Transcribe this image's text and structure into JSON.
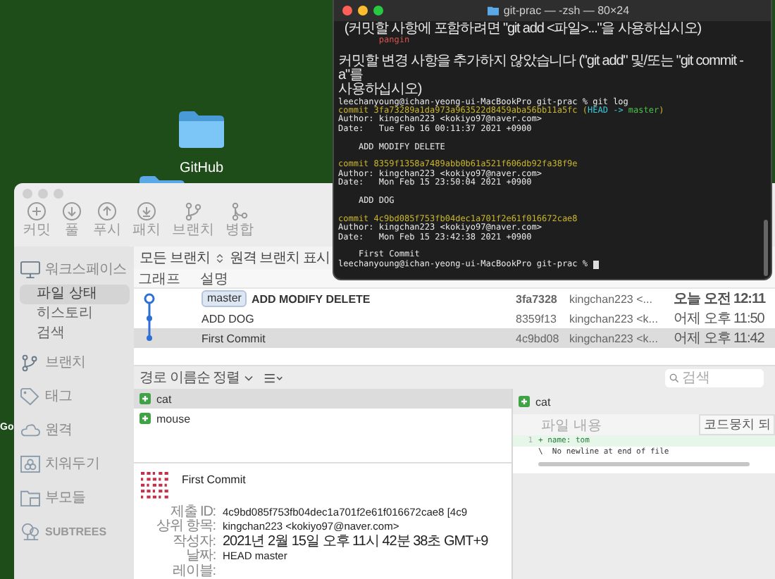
{
  "desktop": {
    "icons": [
      {
        "label": "GitHub"
      }
    ],
    "edge_label": "Go"
  },
  "terminal": {
    "title": "git-prac — -zsh — 80×24",
    "lines": [
      {
        "kind": "notice",
        "segments": [
          {
            "kind": "plain",
            "text": "  (커밋할 사항에 포함하려면 \"git add <파일>...\"을 사용하십시오)"
          }
        ]
      },
      {
        "kind": "text",
        "segments": [
          {
            "kind": "untracked",
            "text": "        pangin"
          }
        ]
      },
      {
        "kind": "blank"
      },
      {
        "kind": "notice",
        "segments": [
          {
            "kind": "plain",
            "text": "커밋할 변경 사항을 추가하지 않았습니다 (\"git add\" 및/또는 \"git commit -a\"를"
          }
        ]
      },
      {
        "kind": "notice",
        "segments": [
          {
            "kind": "plain",
            "text": "사용하십시오)"
          }
        ]
      },
      {
        "kind": "text",
        "segments": [
          {
            "kind": "plain",
            "text": "leechanyoung@ichan-yeong-ui-MacBookPro git-prac % git log"
          }
        ]
      },
      {
        "kind": "text",
        "segments": [
          {
            "kind": "commit",
            "text": "commit 3fa73289a1da973a963522d8459aba56bb11a5fc ("
          },
          {
            "kind": "head",
            "text": "HEAD -> "
          },
          {
            "kind": "branch",
            "text": "master"
          },
          {
            "kind": "commit",
            "text": ")"
          }
        ]
      },
      {
        "kind": "text",
        "segments": [
          {
            "kind": "plain",
            "text": "Author: kingchan223 <kokiyo97@naver.com>"
          }
        ]
      },
      {
        "kind": "text",
        "segments": [
          {
            "kind": "plain",
            "text": "Date:   Tue Feb 16 00:11:37 2021 +0900"
          }
        ]
      },
      {
        "kind": "blank"
      },
      {
        "kind": "text",
        "segments": [
          {
            "kind": "plain",
            "text": "    ADD MODIFY DELETE"
          }
        ]
      },
      {
        "kind": "blank"
      },
      {
        "kind": "text",
        "segments": [
          {
            "kind": "commit",
            "text": "commit 8359f1358a7489abb0b61a521f606db92fa38f9e"
          }
        ]
      },
      {
        "kind": "text",
        "segments": [
          {
            "kind": "plain",
            "text": "Author: kingchan223 <kokiyo97@naver.com>"
          }
        ]
      },
      {
        "kind": "text",
        "segments": [
          {
            "kind": "plain",
            "text": "Date:   Mon Feb 15 23:50:04 2021 +0900"
          }
        ]
      },
      {
        "kind": "blank"
      },
      {
        "kind": "text",
        "segments": [
          {
            "kind": "plain",
            "text": "    ADD DOG"
          }
        ]
      },
      {
        "kind": "blank"
      },
      {
        "kind": "text",
        "segments": [
          {
            "kind": "commit",
            "text": "commit 4c9bd085f753fb04dec1a701f2e61f016672cae8"
          }
        ]
      },
      {
        "kind": "text",
        "segments": [
          {
            "kind": "plain",
            "text": "Author: kingchan223 <kokiyo97@naver.com>"
          }
        ]
      },
      {
        "kind": "text",
        "segments": [
          {
            "kind": "plain",
            "text": "Date:   Mon Feb 15 23:42:38 2021 +0900"
          }
        ]
      },
      {
        "kind": "blank"
      },
      {
        "kind": "text",
        "segments": [
          {
            "kind": "plain",
            "text": "    First Commit"
          }
        ]
      },
      {
        "kind": "prompt",
        "segments": [
          {
            "kind": "plain",
            "text": "leechanyoung@ichan-yeong-ui-MacBookPro git-prac % "
          }
        ]
      }
    ]
  },
  "sourcetree": {
    "toolbar": [
      {
        "kind": "commit",
        "label": "커밋"
      },
      {
        "kind": "pull",
        "label": "풀"
      },
      {
        "kind": "push",
        "label": "푸시"
      },
      {
        "kind": "fetch",
        "label": "패치"
      },
      {
        "kind": "branch",
        "label": "브랜치"
      },
      {
        "kind": "merge",
        "label": "병합"
      }
    ],
    "sidebar": [
      {
        "kind": "monitor",
        "label": "워크스페이스",
        "children": [
          {
            "label": "파일 상태",
            "selected": true
          },
          {
            "label": "히스토리",
            "selected": false
          },
          {
            "label": "검색",
            "selected": false
          }
        ]
      },
      {
        "kind": "branch",
        "label": "브랜치"
      },
      {
        "kind": "tag",
        "label": "태그"
      },
      {
        "kind": "cloud",
        "label": "원격"
      },
      {
        "kind": "stash",
        "label": "치워두기"
      },
      {
        "kind": "folder",
        "label": "부모들"
      },
      {
        "kind": "tree",
        "label": "SUBTREES"
      }
    ],
    "branch_filter": "모든 브랜치",
    "remote_toggle": "원격 브랜치 표시",
    "columns": [
      "그래프",
      "설명"
    ],
    "commits": [
      {
        "selected": false,
        "head": true,
        "branch": "master",
        "description": "ADD MODIFY DELETE",
        "hash": "3fa7328",
        "author": "kingchan223 <...",
        "date": "오늘 오전 12:11"
      },
      {
        "selected": false,
        "head": false,
        "description": "ADD DOG",
        "hash": "8359f13",
        "author": "kingchan223 <k...",
        "date": "어제 오후 11:50"
      },
      {
        "selected": true,
        "head": false,
        "description": "First Commit",
        "hash": "4c9bd08",
        "author": "kingchan223 <k...",
        "date": "어제 오후 11:42"
      }
    ],
    "sort_menu": "경로 이름순 정렬",
    "search": {
      "placeholder": "검색"
    },
    "files": [
      {
        "name": "cat",
        "selected": true
      },
      {
        "name": "mouse",
        "selected": false
      }
    ],
    "commit_detail": {
      "message": "First Commit",
      "labels": [
        "제출 ID:",
        "상위 항목:",
        "작성자:",
        "날짜:",
        "레이블:"
      ],
      "values": [
        "4c9bd085f753fb04dec1a701f2e61f016672cae8 [4c9",
        "kingchan223 <kokiyo97@naver.com>",
        "2021년 2월 15일 오후 11시 42분 38초 GMT+9",
        "HEAD master"
      ]
    },
    "diff": {
      "file": "cat",
      "header": "파일 내용",
      "hunk_button": "코드뭉치 되",
      "lines": [
        {
          "kind": "added",
          "number": "1",
          "text": "+ name: tom"
        },
        {
          "kind": "note",
          "text": "\\  No newline at end of file"
        }
      ]
    }
  }
}
